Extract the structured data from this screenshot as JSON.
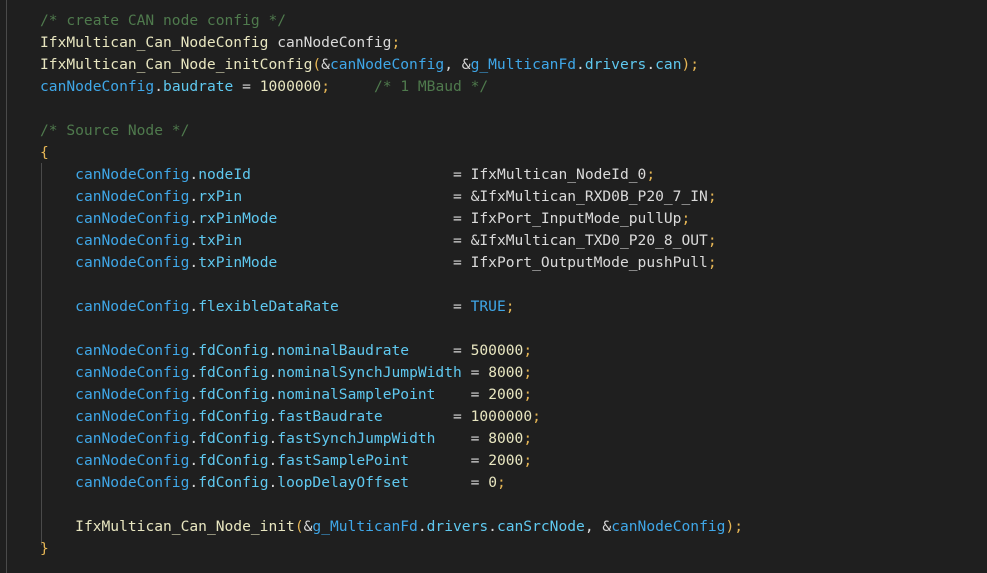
{
  "editor": {
    "language": "c",
    "background_color": "#1f1f1f",
    "indent_guide_color": "#4a4a4a",
    "colors": {
      "comment": "#4f7a4d",
      "type": "#e8e6c0",
      "function": "#e8e6c0",
      "variable": "#3fa7e8",
      "property": "#5fc9f0",
      "number": "#e8e6c0",
      "constant": "#3fa7e8",
      "bracket": "#e6b655",
      "plain_text": "#d8d8d8"
    }
  },
  "code": {
    "lines": [
      {
        "tokens": [
          {
            "t": "/* create CAN node config */",
            "c": "c-comment"
          }
        ]
      },
      {
        "tokens": [
          {
            "t": "IfxMultican_Can_NodeConfig",
            "c": "c-type"
          },
          {
            "t": " ",
            "c": "c-plain"
          },
          {
            "t": "canNodeConfig",
            "c": "c-ident"
          },
          {
            "t": ";",
            "c": "c-brkt-1"
          }
        ]
      },
      {
        "tokens": [
          {
            "t": "IfxMultican_Can_Node_initConfig",
            "c": "c-func"
          },
          {
            "t": "(",
            "c": "c-brkt-1"
          },
          {
            "t": "&",
            "c": "c-op"
          },
          {
            "t": "canNodeConfig",
            "c": "c-var"
          },
          {
            "t": ", ",
            "c": "c-plain"
          },
          {
            "t": "&",
            "c": "c-op"
          },
          {
            "t": "g_MulticanFd",
            "c": "c-var"
          },
          {
            "t": ".",
            "c": "c-plain"
          },
          {
            "t": "drivers",
            "c": "c-prop"
          },
          {
            "t": ".",
            "c": "c-plain"
          },
          {
            "t": "can",
            "c": "c-prop"
          },
          {
            "t": ")",
            "c": "c-brkt-1"
          },
          {
            "t": ";",
            "c": "c-brkt-1"
          }
        ]
      },
      {
        "tokens": [
          {
            "t": "canNodeConfig",
            "c": "c-var"
          },
          {
            "t": ".",
            "c": "c-plain"
          },
          {
            "t": "baudrate",
            "c": "c-prop"
          },
          {
            "t": " ",
            "c": "c-plain"
          },
          {
            "t": "=",
            "c": "c-op"
          },
          {
            "t": " ",
            "c": "c-plain"
          },
          {
            "t": "1000000",
            "c": "c-num"
          },
          {
            "t": ";",
            "c": "c-brkt-1"
          },
          {
            "t": "     ",
            "c": "c-plain"
          },
          {
            "t": "/* 1 MBaud */",
            "c": "c-comment"
          }
        ]
      },
      {
        "tokens": []
      },
      {
        "tokens": [
          {
            "t": "/* Source Node */",
            "c": "c-comment"
          }
        ]
      },
      {
        "tokens": [
          {
            "t": "{",
            "c": "c-brkt-1"
          }
        ]
      },
      {
        "tokens": [
          {
            "t": "    ",
            "c": "c-plain"
          },
          {
            "t": "canNodeConfig",
            "c": "c-var"
          },
          {
            "t": ".",
            "c": "c-plain"
          },
          {
            "t": "nodeId",
            "c": "c-prop"
          },
          {
            "t": "                       ",
            "c": "c-plain"
          },
          {
            "t": "=",
            "c": "c-op"
          },
          {
            "t": " ",
            "c": "c-plain"
          },
          {
            "t": "IfxMultican_NodeId_0",
            "c": "c-ident"
          },
          {
            "t": ";",
            "c": "c-brkt-1"
          }
        ]
      },
      {
        "tokens": [
          {
            "t": "    ",
            "c": "c-plain"
          },
          {
            "t": "canNodeConfig",
            "c": "c-var"
          },
          {
            "t": ".",
            "c": "c-plain"
          },
          {
            "t": "rxPin",
            "c": "c-prop"
          },
          {
            "t": "                        ",
            "c": "c-plain"
          },
          {
            "t": "=",
            "c": "c-op"
          },
          {
            "t": " ",
            "c": "c-plain"
          },
          {
            "t": "&",
            "c": "c-op"
          },
          {
            "t": "IfxMultican_RXD0B_P20_7_IN",
            "c": "c-ident"
          },
          {
            "t": ";",
            "c": "c-brkt-1"
          }
        ]
      },
      {
        "tokens": [
          {
            "t": "    ",
            "c": "c-plain"
          },
          {
            "t": "canNodeConfig",
            "c": "c-var"
          },
          {
            "t": ".",
            "c": "c-plain"
          },
          {
            "t": "rxPinMode",
            "c": "c-prop"
          },
          {
            "t": "                    ",
            "c": "c-plain"
          },
          {
            "t": "=",
            "c": "c-op"
          },
          {
            "t": " ",
            "c": "c-plain"
          },
          {
            "t": "IfxPort_InputMode_pullUp",
            "c": "c-ident"
          },
          {
            "t": ";",
            "c": "c-brkt-1"
          }
        ]
      },
      {
        "tokens": [
          {
            "t": "    ",
            "c": "c-plain"
          },
          {
            "t": "canNodeConfig",
            "c": "c-var"
          },
          {
            "t": ".",
            "c": "c-plain"
          },
          {
            "t": "txPin",
            "c": "c-prop"
          },
          {
            "t": "                        ",
            "c": "c-plain"
          },
          {
            "t": "=",
            "c": "c-op"
          },
          {
            "t": " ",
            "c": "c-plain"
          },
          {
            "t": "&",
            "c": "c-op"
          },
          {
            "t": "IfxMultican_TXD0_P20_8_OUT",
            "c": "c-ident"
          },
          {
            "t": ";",
            "c": "c-brkt-1"
          }
        ]
      },
      {
        "tokens": [
          {
            "t": "    ",
            "c": "c-plain"
          },
          {
            "t": "canNodeConfig",
            "c": "c-var"
          },
          {
            "t": ".",
            "c": "c-plain"
          },
          {
            "t": "txPinMode",
            "c": "c-prop"
          },
          {
            "t": "                    ",
            "c": "c-plain"
          },
          {
            "t": "=",
            "c": "c-op"
          },
          {
            "t": " ",
            "c": "c-plain"
          },
          {
            "t": "IfxPort_OutputMode_pushPull",
            "c": "c-ident"
          },
          {
            "t": ";",
            "c": "c-brkt-1"
          }
        ]
      },
      {
        "tokens": []
      },
      {
        "tokens": [
          {
            "t": "    ",
            "c": "c-plain"
          },
          {
            "t": "canNodeConfig",
            "c": "c-var"
          },
          {
            "t": ".",
            "c": "c-plain"
          },
          {
            "t": "flexibleDataRate",
            "c": "c-prop"
          },
          {
            "t": "             ",
            "c": "c-plain"
          },
          {
            "t": "=",
            "c": "c-op"
          },
          {
            "t": " ",
            "c": "c-plain"
          },
          {
            "t": "TRUE",
            "c": "c-const"
          },
          {
            "t": ";",
            "c": "c-brkt-1"
          }
        ]
      },
      {
        "tokens": []
      },
      {
        "tokens": [
          {
            "t": "    ",
            "c": "c-plain"
          },
          {
            "t": "canNodeConfig",
            "c": "c-var"
          },
          {
            "t": ".",
            "c": "c-plain"
          },
          {
            "t": "fdConfig",
            "c": "c-prop"
          },
          {
            "t": ".",
            "c": "c-plain"
          },
          {
            "t": "nominalBaudrate",
            "c": "c-prop"
          },
          {
            "t": "     ",
            "c": "c-plain"
          },
          {
            "t": "=",
            "c": "c-op"
          },
          {
            "t": " ",
            "c": "c-plain"
          },
          {
            "t": "500000",
            "c": "c-num"
          },
          {
            "t": ";",
            "c": "c-brkt-1"
          }
        ]
      },
      {
        "tokens": [
          {
            "t": "    ",
            "c": "c-plain"
          },
          {
            "t": "canNodeConfig",
            "c": "c-var"
          },
          {
            "t": ".",
            "c": "c-plain"
          },
          {
            "t": "fdConfig",
            "c": "c-prop"
          },
          {
            "t": ".",
            "c": "c-plain"
          },
          {
            "t": "nominalSynchJumpWidth",
            "c": "c-prop"
          },
          {
            "t": " ",
            "c": "c-plain"
          },
          {
            "t": "=",
            "c": "c-op"
          },
          {
            "t": " ",
            "c": "c-plain"
          },
          {
            "t": "8000",
            "c": "c-num"
          },
          {
            "t": ";",
            "c": "c-brkt-1"
          }
        ]
      },
      {
        "tokens": [
          {
            "t": "    ",
            "c": "c-plain"
          },
          {
            "t": "canNodeConfig",
            "c": "c-var"
          },
          {
            "t": ".",
            "c": "c-plain"
          },
          {
            "t": "fdConfig",
            "c": "c-prop"
          },
          {
            "t": ".",
            "c": "c-plain"
          },
          {
            "t": "nominalSamplePoint",
            "c": "c-prop"
          },
          {
            "t": "    ",
            "c": "c-plain"
          },
          {
            "t": "=",
            "c": "c-op"
          },
          {
            "t": " ",
            "c": "c-plain"
          },
          {
            "t": "2000",
            "c": "c-num"
          },
          {
            "t": ";",
            "c": "c-brkt-1"
          }
        ]
      },
      {
        "tokens": [
          {
            "t": "    ",
            "c": "c-plain"
          },
          {
            "t": "canNodeConfig",
            "c": "c-var"
          },
          {
            "t": ".",
            "c": "c-plain"
          },
          {
            "t": "fdConfig",
            "c": "c-prop"
          },
          {
            "t": ".",
            "c": "c-plain"
          },
          {
            "t": "fastBaudrate",
            "c": "c-prop"
          },
          {
            "t": "        ",
            "c": "c-plain"
          },
          {
            "t": "=",
            "c": "c-op"
          },
          {
            "t": " ",
            "c": "c-plain"
          },
          {
            "t": "1000000",
            "c": "c-num"
          },
          {
            "t": ";",
            "c": "c-brkt-1"
          }
        ]
      },
      {
        "tokens": [
          {
            "t": "    ",
            "c": "c-plain"
          },
          {
            "t": "canNodeConfig",
            "c": "c-var"
          },
          {
            "t": ".",
            "c": "c-plain"
          },
          {
            "t": "fdConfig",
            "c": "c-prop"
          },
          {
            "t": ".",
            "c": "c-plain"
          },
          {
            "t": "fastSynchJumpWidth",
            "c": "c-prop"
          },
          {
            "t": "    ",
            "c": "c-plain"
          },
          {
            "t": "=",
            "c": "c-op"
          },
          {
            "t": " ",
            "c": "c-plain"
          },
          {
            "t": "8000",
            "c": "c-num"
          },
          {
            "t": ";",
            "c": "c-brkt-1"
          }
        ]
      },
      {
        "tokens": [
          {
            "t": "    ",
            "c": "c-plain"
          },
          {
            "t": "canNodeConfig",
            "c": "c-var"
          },
          {
            "t": ".",
            "c": "c-plain"
          },
          {
            "t": "fdConfig",
            "c": "c-prop"
          },
          {
            "t": ".",
            "c": "c-plain"
          },
          {
            "t": "fastSamplePoint",
            "c": "c-prop"
          },
          {
            "t": "       ",
            "c": "c-plain"
          },
          {
            "t": "=",
            "c": "c-op"
          },
          {
            "t": " ",
            "c": "c-plain"
          },
          {
            "t": "2000",
            "c": "c-num"
          },
          {
            "t": ";",
            "c": "c-brkt-1"
          }
        ]
      },
      {
        "tokens": [
          {
            "t": "    ",
            "c": "c-plain"
          },
          {
            "t": "canNodeConfig",
            "c": "c-var"
          },
          {
            "t": ".",
            "c": "c-plain"
          },
          {
            "t": "fdConfig",
            "c": "c-prop"
          },
          {
            "t": ".",
            "c": "c-plain"
          },
          {
            "t": "loopDelayOffset",
            "c": "c-prop"
          },
          {
            "t": "       ",
            "c": "c-plain"
          },
          {
            "t": "=",
            "c": "c-op"
          },
          {
            "t": " ",
            "c": "c-plain"
          },
          {
            "t": "0",
            "c": "c-num"
          },
          {
            "t": ";",
            "c": "c-brkt-1"
          }
        ]
      },
      {
        "tokens": []
      },
      {
        "tokens": [
          {
            "t": "    ",
            "c": "c-plain"
          },
          {
            "t": "IfxMultican_Can_Node_init",
            "c": "c-func"
          },
          {
            "t": "(",
            "c": "c-brkt-1"
          },
          {
            "t": "&",
            "c": "c-op"
          },
          {
            "t": "g_MulticanFd",
            "c": "c-var"
          },
          {
            "t": ".",
            "c": "c-plain"
          },
          {
            "t": "drivers",
            "c": "c-prop"
          },
          {
            "t": ".",
            "c": "c-plain"
          },
          {
            "t": "canSrcNode",
            "c": "c-prop"
          },
          {
            "t": ", ",
            "c": "c-plain"
          },
          {
            "t": "&",
            "c": "c-op"
          },
          {
            "t": "canNodeConfig",
            "c": "c-var"
          },
          {
            "t": ")",
            "c": "c-brkt-1"
          },
          {
            "t": ";",
            "c": "c-brkt-1"
          }
        ]
      },
      {
        "tokens": [
          {
            "t": "}",
            "c": "c-brkt-1"
          }
        ]
      }
    ]
  }
}
